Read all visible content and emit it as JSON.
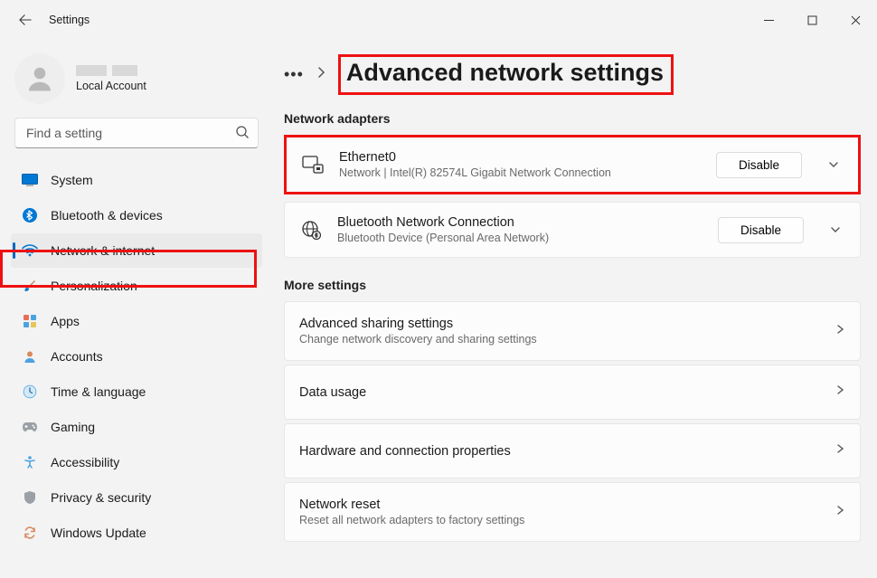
{
  "window": {
    "title": "Settings"
  },
  "profile": {
    "account_type": "Local Account"
  },
  "search": {
    "placeholder": "Find a setting"
  },
  "sidebar": {
    "items": [
      {
        "label": "System"
      },
      {
        "label": "Bluetooth & devices"
      },
      {
        "label": "Network & internet"
      },
      {
        "label": "Personalization"
      },
      {
        "label": "Apps"
      },
      {
        "label": "Accounts"
      },
      {
        "label": "Time & language"
      },
      {
        "label": "Gaming"
      },
      {
        "label": "Accessibility"
      },
      {
        "label": "Privacy & security"
      },
      {
        "label": "Windows Update"
      }
    ]
  },
  "page": {
    "title": "Advanced network settings",
    "adapters_label": "Network adapters",
    "adapters": [
      {
        "name": "Ethernet0",
        "desc": "Network | Intel(R) 82574L Gigabit Network Connection",
        "action": "Disable"
      },
      {
        "name": "Bluetooth Network Connection",
        "desc": "Bluetooth Device (Personal Area Network)",
        "action": "Disable"
      }
    ],
    "more_label": "More settings",
    "more": [
      {
        "title": "Advanced sharing settings",
        "sub": "Change network discovery and sharing settings"
      },
      {
        "title": "Data usage",
        "sub": ""
      },
      {
        "title": "Hardware and connection properties",
        "sub": ""
      },
      {
        "title": "Network reset",
        "sub": "Reset all network adapters to factory settings"
      }
    ]
  }
}
